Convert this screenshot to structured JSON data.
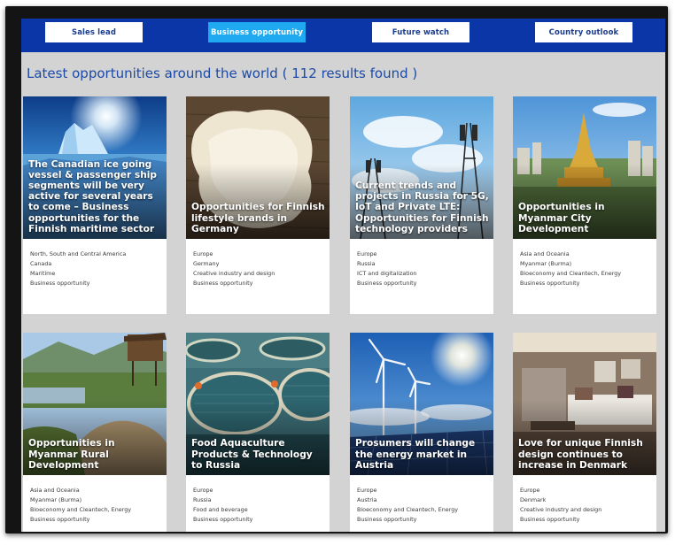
{
  "tabs": [
    {
      "label": "Sales lead",
      "active": false
    },
    {
      "label": "Business opportunity",
      "active": true
    },
    {
      "label": "Future watch",
      "active": false
    },
    {
      "label": "Country outlook",
      "active": false
    }
  ],
  "heading": "Latest opportunities around the world ( 112 results found )",
  "colors": {
    "nav_bg": "#0a36a8",
    "active_tab": "#1ea9f0",
    "heading": "#1c4aa6",
    "page_bg": "#d3d3d3"
  },
  "cards": [
    {
      "title": "The Canadian ice going vessel & passenger ship segments will be very active for several years to come – Business opportunities for the Finnish maritime sector",
      "tags": [
        "North, South and Central America",
        "Canada",
        "Maritime",
        "Business opportunity"
      ]
    },
    {
      "title": "Opportunities for Finnish lifestyle brands in Germany",
      "tags": [
        "Europe",
        "Germany",
        "Creative industry and design",
        "Business opportunity"
      ]
    },
    {
      "title": "Current trends and projects in Russia for 5G, IoT and Private LTE: Opportunities for Finnish technology providers",
      "tags": [
        "Europe",
        "Russia",
        "ICT and digitalization",
        "Business opportunity"
      ]
    },
    {
      "title": "Opportunities in Myanmar City Development",
      "tags": [
        "Asia and Oceania",
        "Myanmar (Burma)",
        "Bioeconomy and Cleantech, Energy",
        "Business opportunity"
      ]
    },
    {
      "title": "Opportunities in Myanmar Rural Development",
      "tags": [
        "Asia and Oceania",
        "Myanmar (Burma)",
        "Bioeconomy and Cleantech, Energy",
        "Business opportunity"
      ]
    },
    {
      "title": "Food Aquaculture Products & Technology to Russia",
      "tags": [
        "Europe",
        "Russia",
        "Food and beverage",
        "Business opportunity"
      ]
    },
    {
      "title": "Prosumers will change the energy market in Austria",
      "tags": [
        "Europe",
        "Austria",
        "Bioeconomy and Cleantech, Energy",
        "Business opportunity"
      ]
    },
    {
      "title": "Love for unique Finnish design continues to increase in Denmark",
      "tags": [
        "Europe",
        "Denmark",
        "Creative industry and design",
        "Business opportunity"
      ]
    }
  ]
}
